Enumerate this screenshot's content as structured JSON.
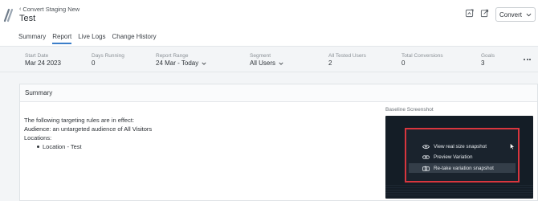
{
  "header": {
    "breadcrumb": "Convert Staging New",
    "title": "Test",
    "convert_button": "Convert"
  },
  "tabs": [
    {
      "label": "Summary"
    },
    {
      "label": "Report"
    },
    {
      "label": "Live Logs"
    },
    {
      "label": "Change History"
    }
  ],
  "active_tab": "Report",
  "stats": {
    "start_date": {
      "label": "Start Date",
      "value": "Mar 24 2023"
    },
    "days_running": {
      "label": "Days Running",
      "value": "0"
    },
    "report_range": {
      "label": "Report Range",
      "value": "24 Mar - Today"
    },
    "segment": {
      "label": "Segment",
      "value": "All Users"
    },
    "all_tested_users": {
      "label": "All Tested Users",
      "value": "2"
    },
    "total_conversions": {
      "label": "Total Conversions",
      "value": "0"
    },
    "goals": {
      "label": "Goals",
      "value": "3"
    }
  },
  "summary": {
    "heading": "Summary",
    "intro": "The following targeting rules are in effect:",
    "audience_label": "Audience:",
    "audience_text": "an untargeted audience of",
    "audience_value": "All Visitors",
    "locations_label": "Locations:",
    "locations": [
      "Location - Test"
    ]
  },
  "screenshot": {
    "label": "Baseline Screenshot",
    "menu": [
      {
        "label": "View real size snapshot",
        "icon": "eye-icon"
      },
      {
        "label": "Preview Variation",
        "icon": "link-icon"
      },
      {
        "label": "Re-take variation snapshot",
        "icon": "camera-icon"
      }
    ]
  },
  "colors": {
    "accent": "#3b7ec9",
    "highlight_border": "#d9363e",
    "screenshot_bg": "#141d26"
  }
}
